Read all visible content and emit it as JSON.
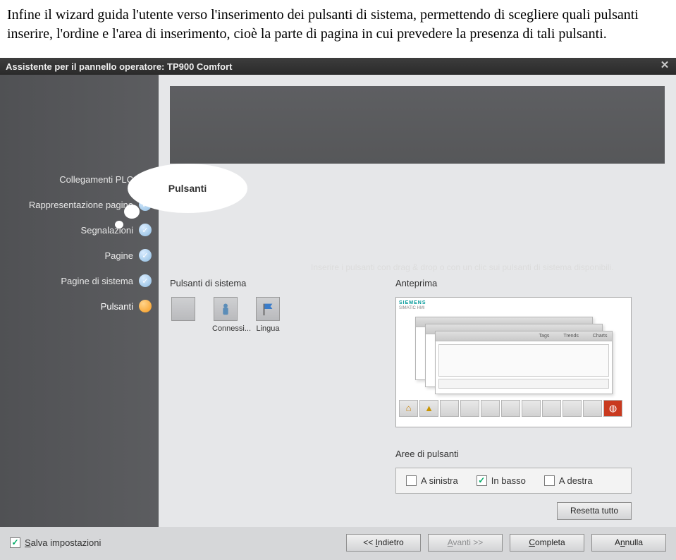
{
  "intro_text": "Infine il wizard guida l'utente verso l'inserimento dei pulsanti di sistema, permettendo di scegliere quali pulsanti inserire, l'ordine e l'area di inserimento, cioè la parte di pagina in cui prevedere la presenza di tali pulsanti.",
  "wizard": {
    "title": "Assistente per il pannello operatore: TP900 Comfort",
    "bubble_title": "Pulsanti",
    "instruction": "Inserire i pulsanti con drag & drop o con un clic sui pulsanti di sistema disponibili.",
    "steps": [
      "Collegamenti PLC",
      "Rappresentazione pagine",
      "Segnalazioni",
      "Pagine",
      "Pagine di sistema",
      "Pulsanti"
    ],
    "current_step_index": 5,
    "system_buttons": {
      "title": "Pulsanti di sistema",
      "items": [
        {
          "label": "",
          "icon": "blank"
        },
        {
          "label": "Connessi...",
          "icon": "user"
        },
        {
          "label": "Lingua",
          "icon": "flag"
        }
      ]
    },
    "preview": {
      "title": "Anteprima",
      "brand": "SIEMENS",
      "product": "SIMATIC HMI",
      "window_tabs": [
        "Tags",
        "Trends",
        "Charts"
      ],
      "bottom_icons": {
        "home": "🏠",
        "warn1": "!",
        "stop": "◍"
      }
    },
    "areas": {
      "title": "Aree di pulsanti",
      "options": [
        {
          "label": "A sinistra",
          "checked": false
        },
        {
          "label": "In basso",
          "checked": true
        },
        {
          "label": "A destra",
          "checked": false
        }
      ]
    },
    "reset_label": "Resetta tutto"
  },
  "footer": {
    "save_label": "Salva impostazioni",
    "save_checked": true,
    "back": "<< Indietro",
    "next": "Avanti >>",
    "finish": "Completa",
    "cancel": "Annulla"
  }
}
